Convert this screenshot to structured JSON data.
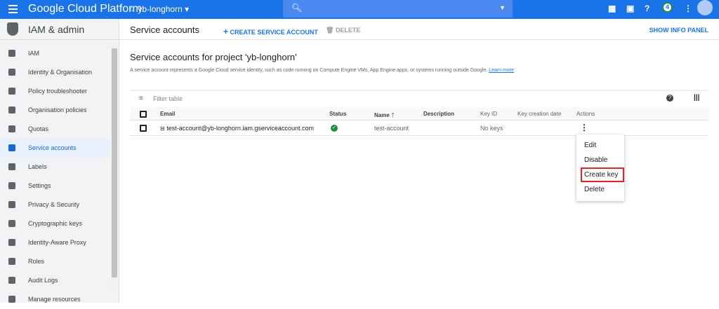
{
  "topbar": {
    "brand": "Google Cloud Platform",
    "project": "yb-longhorn",
    "notifications": "4"
  },
  "sidebar": {
    "title": "IAM & admin",
    "items": [
      {
        "label": "IAM",
        "icon": "person-add-icon"
      },
      {
        "label": "Identity & Organisation",
        "icon": "account-circle-icon"
      },
      {
        "label": "Policy troubleshooter",
        "icon": "wrench-icon"
      },
      {
        "label": "Organisation policies",
        "icon": "list-icon"
      },
      {
        "label": "Quotas",
        "icon": "quota-icon"
      },
      {
        "label": "Service accounts",
        "icon": "service-account-icon",
        "active": true
      },
      {
        "label": "Labels",
        "icon": "label-icon"
      },
      {
        "label": "Settings",
        "icon": "gear-icon"
      },
      {
        "label": "Privacy & Security",
        "icon": "shield-icon"
      },
      {
        "label": "Cryptographic keys",
        "icon": "key-shield-icon"
      },
      {
        "label": "Identity-Aware Proxy",
        "icon": "proxy-icon"
      },
      {
        "label": "Roles",
        "icon": "roles-icon"
      },
      {
        "label": "Audit Logs",
        "icon": "logs-icon"
      },
      {
        "label": "Manage resources",
        "icon": "folder-icon"
      }
    ]
  },
  "header": {
    "title": "Service accounts",
    "create": "CREATE SERVICE ACCOUNT",
    "delete": "DELETE",
    "info": "SHOW INFO PANEL"
  },
  "main": {
    "title": "Service accounts for project 'yb-longhorn'",
    "desc": "A service account represents a Google Cloud service identity, such as code running on Compute Engine VMs, App Engine apps, or systems running outside Google.",
    "learn": "Learn more",
    "filter": "Filter table"
  },
  "table": {
    "columns": [
      "Email",
      "Status",
      "Name",
      "Description",
      "Key ID",
      "Key creation date",
      "Actions"
    ],
    "rows": [
      {
        "email": "test-account@yb-longhorn.iam.gserviceaccount.com",
        "name": "test-account",
        "key_id": "No keys"
      }
    ]
  },
  "menu": [
    "Edit",
    "Disable",
    "Create key",
    "Delete"
  ]
}
